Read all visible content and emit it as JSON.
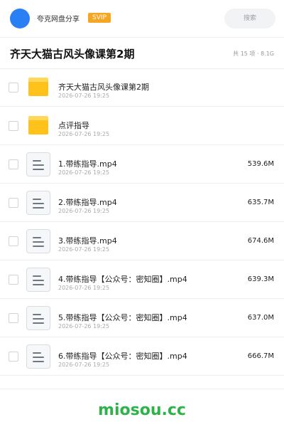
{
  "header": {
    "share_name": "夸克网盘分享",
    "badge": "SVIP",
    "search_placeholder": "搜索",
    "avatar_color": "#2a7ff5"
  },
  "folder": {
    "title": "齐天大猫古风头像课第2期",
    "meta": "共 15 项 · 8.1G"
  },
  "items": [
    {
      "type": "folder",
      "name": "齐天大猫古风头像课第2期",
      "date": "2026-07-26 19:25",
      "size": ""
    },
    {
      "type": "folder",
      "name": "点评指导",
      "date": "2026-07-26 19:25",
      "size": ""
    },
    {
      "type": "video",
      "name": "1.带练指导.mp4",
      "date": "2026-07-26 19:25",
      "size": "539.6M"
    },
    {
      "type": "video",
      "name": "2.带练指导.mp4",
      "date": "2026-07-26 19:25",
      "size": "635.7M"
    },
    {
      "type": "video",
      "name": "3.带练指导.mp4",
      "date": "2026-07-26 19:25",
      "size": "674.6M"
    },
    {
      "type": "video",
      "name": "4.带练指导【公众号：密知圈】.mp4",
      "date": "2026-07-26 19:25",
      "size": "639.3M"
    },
    {
      "type": "video",
      "name": "5.带练指导【公众号：密知圈】.mp4",
      "date": "2026-07-26 19:25",
      "size": "637.0M"
    },
    {
      "type": "video",
      "name": "6.带练指导【公众号：密知圈】.mp4",
      "date": "2026-07-26 19:25",
      "size": "666.7M"
    }
  ],
  "footer": {
    "watermark": "miosou.cc",
    "color": "#2db34a"
  }
}
